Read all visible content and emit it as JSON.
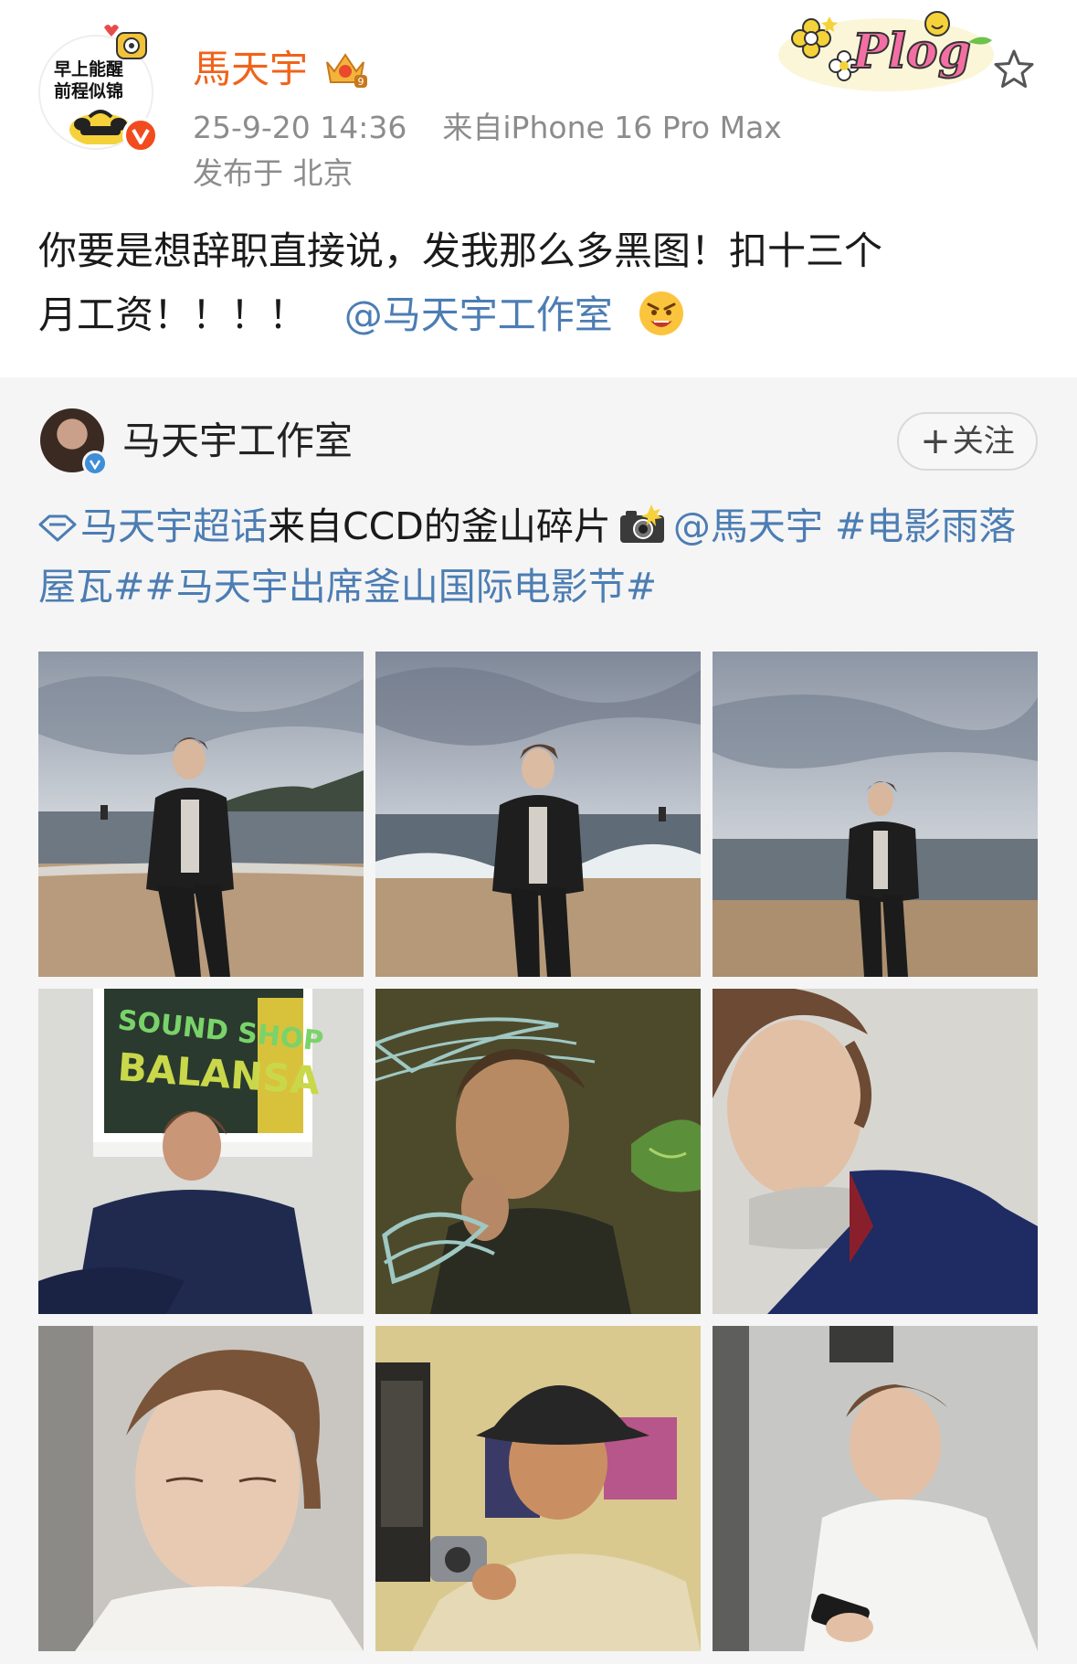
{
  "post": {
    "author": {
      "name": "馬天宇",
      "avatar_text_line1": "早上能醒",
      "avatar_text_line2": "前程似锦",
      "verified_badge": "v"
    },
    "meta": {
      "time": "25-9-20 14:36",
      "source": "来自iPhone 16 Pro Max",
      "location": "发布于 北京"
    },
    "sticker": "Plog",
    "text_line1": "你要是想辞职直接说，发我那么多黑图！扣十三个",
    "text_line2": "月工资！！！！",
    "mention": "@马天宇工作室",
    "icons": {
      "star": "star-outline-icon",
      "crown": "crown-badge-icon",
      "emoji": "angry-face-emoji"
    },
    "colors": {
      "author_name": "#f0631b",
      "link": "#4c7db3",
      "meta": "#8c8c8c",
      "verified": "#f24b1d"
    }
  },
  "repost": {
    "author_name": "马天宇工作室",
    "follow_label": "关注",
    "follow_plus": "+",
    "supertopic": "马天宇超话",
    "text_plain": "来自CCD的釜山碎片",
    "mention": "@馬天宇",
    "hashtag1": "#电影雨落屋瓦#",
    "hashtag2": "#马天宇出席釜山国际电影节#",
    "photos": [
      {
        "scene": "beach-sunset-standing-looking-left"
      },
      {
        "scene": "beach-waves-front-facing"
      },
      {
        "scene": "beach-far-looking-up"
      },
      {
        "scene": "sound-shop-window-sitting"
      },
      {
        "scene": "mirror-reflection-hand-on-chin"
      },
      {
        "scene": "closeup-wall-navy-jacket"
      },
      {
        "scene": "closeup-eyes-closed"
      },
      {
        "scene": "bucket-hat-camera"
      },
      {
        "scene": "haircut-cape-phone"
      }
    ],
    "colors": {
      "background": "#f5f5f5",
      "verified": "#3e8ed8"
    }
  }
}
